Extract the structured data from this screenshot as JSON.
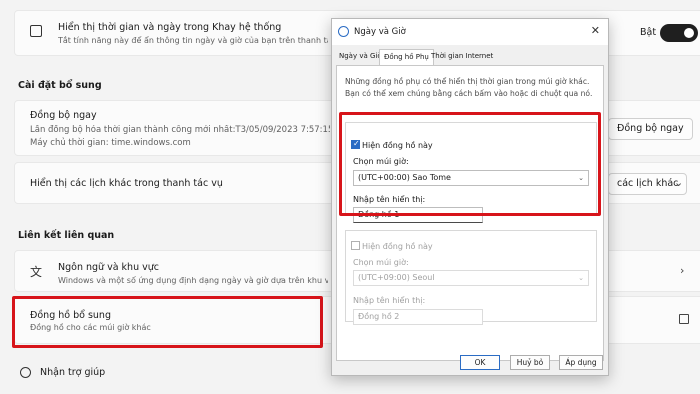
{
  "settings": {
    "sync_row": {
      "title": "Hiển thị thời gian và ngày trong Khay hệ thống",
      "subtitle": "Tắt tính năng này để ẩn thông tin ngày và giờ của bạn trên thanh tác vụ",
      "toggle_label": "Bật"
    },
    "section_extra": "Cài đặt bổ sung",
    "sync_now": {
      "title": "Đồng bộ ngay",
      "line1": "Lần đồng bộ hóa thời gian thành công mới nhất:T3/05/09/2023 7:57:15",
      "line2": "Máy chủ thời gian: time.windows.com",
      "button": "Đồng bộ ngay"
    },
    "calendar_row": {
      "title": "Hiển thị các lịch khác trong thanh tác vụ",
      "dropdown": "các lịch khác"
    },
    "section_links": "Liên kết liên quan",
    "region_row": {
      "title": "Ngôn ngữ và khu vực",
      "subtitle": "Windows và một số ứng dụng định dạng ngày và giờ dựa trên khu vực của"
    },
    "clocks_row": {
      "title": "Đồng hồ bổ sung",
      "subtitle": "Đồng hồ cho các múi giờ khác"
    },
    "help_link": "Nhận trợ giúp"
  },
  "dialog": {
    "title": "Ngày và Giờ",
    "tabs": [
      "Ngày và Giờ",
      "Đồng hồ Phụ",
      "Thời gian Internet"
    ],
    "description": "Những đồng hồ phụ có thể hiển thị thời gian trong múi giờ khác. Bạn có thể xem chúng bằng cách bấm vào hoặc di chuột qua nó.",
    "clock1": {
      "checkbox_label": "Hiện đồng hồ này",
      "timezone_label": "Chọn múi giờ:",
      "timezone_value": "(UTC+00:00) Sao Tome",
      "name_label": "Nhập tên hiển thị:",
      "name_value": "Đồng hồ 1"
    },
    "clock2": {
      "checkbox_label": "Hiện đồng hồ này",
      "timezone_label": "Chọn múi giờ:",
      "timezone_value": "(UTC+09:00) Seoul",
      "name_label": "Nhập tên hiển thị:",
      "name_value": "Đồng hồ 2"
    },
    "buttons": {
      "ok": "OK",
      "cancel": "Huỷ bỏ",
      "apply": "Áp dụng"
    }
  },
  "colors": {
    "highlight": "#d7141a",
    "accent": "#2b6cc4"
  }
}
